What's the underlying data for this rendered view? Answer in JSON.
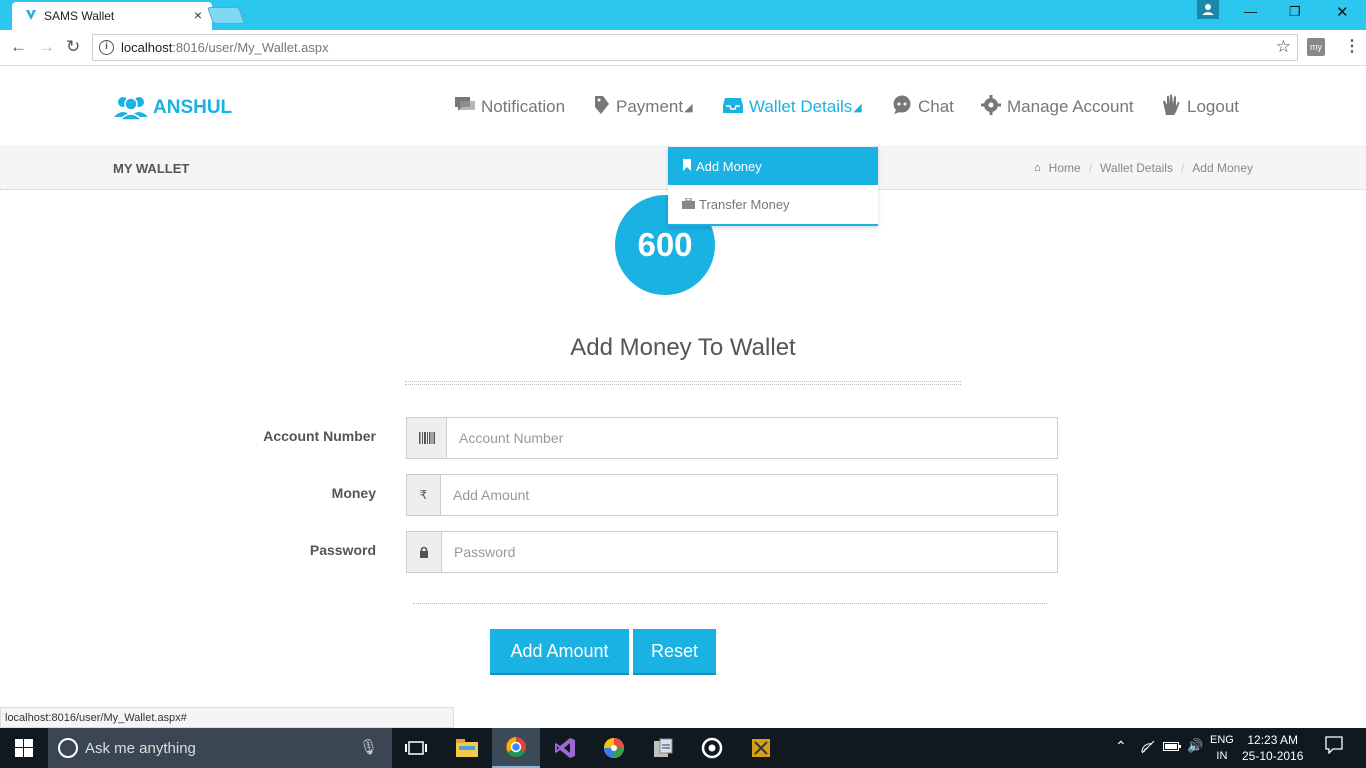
{
  "browser": {
    "tab_title": "SAMS Wallet",
    "tab_close": "×",
    "url_host": "localhost",
    "url_path": ":8016/user/My_Wallet.aspx",
    "status_url": "localhost:8016/user/My_Wallet.aspx#",
    "ext_label": "my"
  },
  "header": {
    "brand": "ANSHUL",
    "nav": [
      {
        "label": "Notification"
      },
      {
        "label": "Payment"
      },
      {
        "label": "Wallet Details"
      },
      {
        "label": "Chat"
      },
      {
        "label": "Manage Account"
      },
      {
        "label": "Logout"
      }
    ]
  },
  "dropdown": {
    "items": [
      {
        "label": "Add Money"
      },
      {
        "label": "Transfer Money"
      }
    ]
  },
  "crumb": {
    "page_title": "MY WALLET",
    "items": [
      "Home",
      "Wallet Details",
      "Add Money"
    ]
  },
  "balance": "600",
  "form": {
    "title": "Add Money To Wallet",
    "fields": [
      {
        "label": "Account Number",
        "placeholder": "Account Number",
        "value": ""
      },
      {
        "label": "Money",
        "placeholder": "Add Amount",
        "value": "",
        "addon": "₹"
      },
      {
        "label": "Password",
        "placeholder": "Password",
        "value": ""
      }
    ],
    "submit": "Add Amount",
    "reset": "Reset"
  },
  "taskbar": {
    "search_placeholder": "Ask me anything",
    "lang_top": "ENG",
    "lang_bottom": "IN",
    "time": "12:23 AM",
    "date": "25-10-2016"
  },
  "colors": {
    "accent": "#1ab1e3",
    "chrome": "#2bc7ef"
  }
}
